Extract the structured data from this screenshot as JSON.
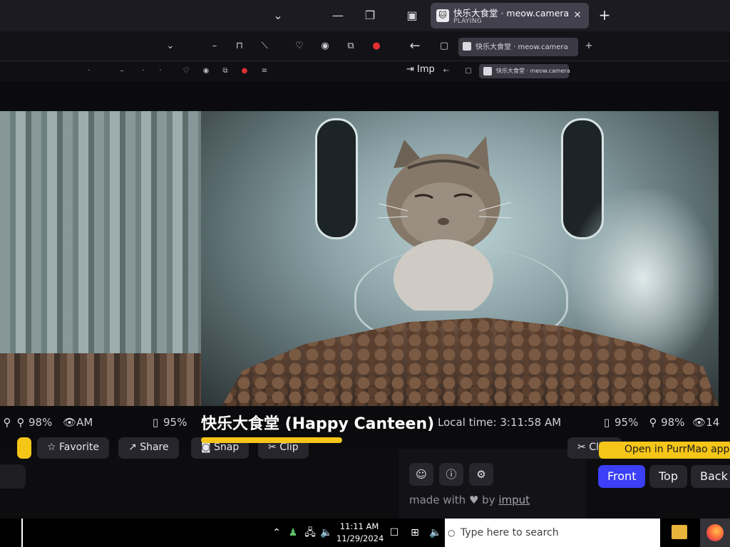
{
  "browser": {
    "tab": {
      "title": "快乐大食堂 · meow.camera",
      "status": "PLAYING",
      "favicon_label": "🐱"
    },
    "mini_tab_title": "快乐大食堂 · meow.camera",
    "mini_tab_title_small": "快乐大食堂 · meow.camera",
    "import_label": "Imp",
    "new_tab": "+",
    "close": "✕"
  },
  "stream": {
    "name": "快乐大食堂 (Happy Canteen)",
    "local_time": "Local time: 3:11:58 AM",
    "stats_left": {
      "stat1": "98%",
      "time_fragment": "AM"
    },
    "stats_right": {
      "battery": "95%",
      "food": "98%",
      "viewers": "14"
    },
    "battery_left": "95%"
  },
  "toolbar": {
    "favorite": "Favorite",
    "share": "Share",
    "snap": "Snap",
    "clip": "Clip",
    "clip2": "Clip"
  },
  "panel": {
    "made_with": "made with",
    "by": "by",
    "author": "imput",
    "open_app": "Open in PurrMao app",
    "views": [
      "Front",
      "Top",
      "Back"
    ]
  },
  "taskbar": {
    "time": "11:11 AM",
    "date": "11/29/2024",
    "search_placeholder": "Type here to search"
  },
  "colors": {
    "accent_yellow": "#f5c518",
    "view_active": "#3b3ff7"
  }
}
